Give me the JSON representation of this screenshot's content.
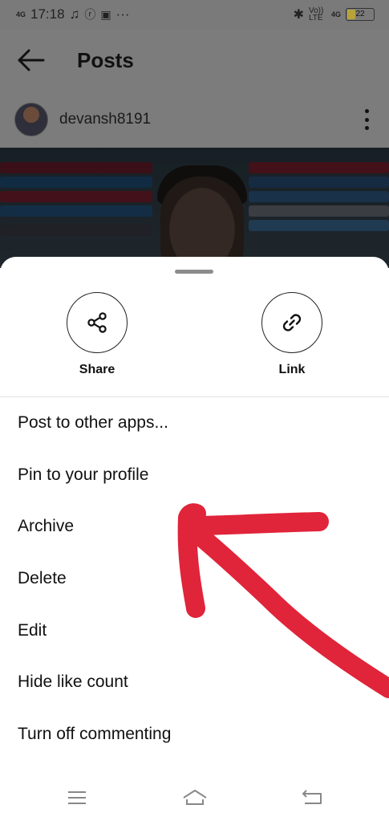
{
  "status_bar": {
    "time": "17:18",
    "network_left": "4G",
    "network_right": "4G",
    "volte": "Vo)) LTE",
    "battery": "22"
  },
  "app_bar": {
    "title": "Posts"
  },
  "post": {
    "username": "devansh8191"
  },
  "sheet": {
    "actions": [
      {
        "label": "Share",
        "icon": "share-icon"
      },
      {
        "label": "Link",
        "icon": "link-icon"
      }
    ],
    "menu": [
      "Post to other apps...",
      "Pin to your profile",
      "Archive",
      "Delete",
      "Edit",
      "Hide like count",
      "Turn off commenting"
    ]
  },
  "annotation": {
    "color": "#e0243a",
    "icon": "red-arrow-annotation"
  },
  "nav_bar": {
    "icons": [
      "menu-icon",
      "home-icon",
      "back-icon"
    ]
  }
}
